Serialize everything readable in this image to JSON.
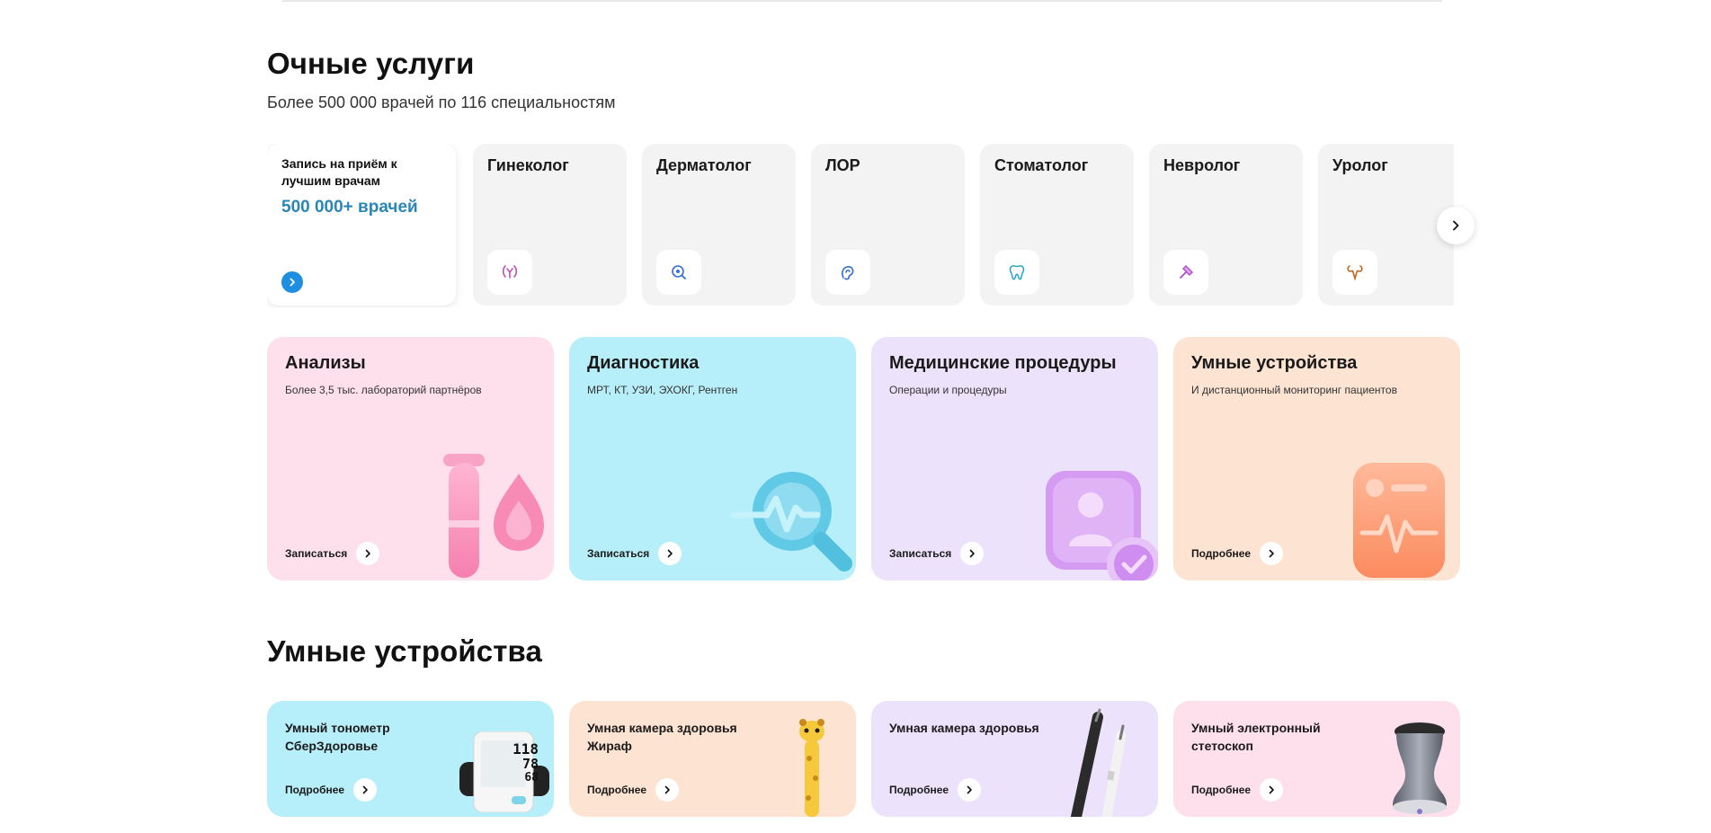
{
  "section_services": {
    "title": "Очные услуги",
    "subtitle": "Более 500 000 врачей по 116 специальностям"
  },
  "promo": {
    "title": "Запись на приём к лучшим врачам",
    "count": "500 000+ врачей",
    "accent": "#2a86b8"
  },
  "specialists": [
    {
      "label": "Гинеколог",
      "icon": "uterus-icon",
      "color": "#c24fb0"
    },
    {
      "label": "Дерматолог",
      "icon": "magnifier-icon",
      "color": "#2f6fd6"
    },
    {
      "label": "ЛОР",
      "icon": "ear-icon",
      "color": "#2f6fd6"
    },
    {
      "label": "Стоматолог",
      "icon": "tooth-icon",
      "color": "#24a6c9"
    },
    {
      "label": "Невролог",
      "icon": "hammer-icon",
      "color": "#b14bc9"
    },
    {
      "label": "Уролог",
      "icon": "kidney-icon",
      "color": "#c2651c"
    }
  ],
  "categories": [
    {
      "title": "Анализы",
      "subtitle": "Более 3,5 тыс. лабораторий партнёров",
      "link": "Записаться",
      "bg": "#fde0ec",
      "icon": "test-tube-blood-icon"
    },
    {
      "title": "Диагностика",
      "subtitle": "МРТ, КТ, УЗИ, ЭХОКГ, Рентген",
      "link": "Записаться",
      "bg": "#b6eef9",
      "icon": "pulse-magnifier-icon"
    },
    {
      "title": "Медицинские процедуры",
      "subtitle": "Операции и процедуры",
      "link": "Записаться",
      "bg": "#ede2fb",
      "icon": "patient-check-icon"
    },
    {
      "title": "Умные устройства",
      "subtitle": "И дистанционный мониторинг пациентов",
      "link": "Подробнее",
      "bg": "#fde3d2",
      "icon": "monitor-pulse-icon"
    }
  ],
  "section_devices": {
    "title": "Умные устройства"
  },
  "devices": [
    {
      "title": "Умный тонометр СберЗдоровье",
      "link": "Подробнее",
      "bg": "#b6eef9",
      "readings": [
        "118",
        "78",
        "68"
      ]
    },
    {
      "title": "Умная камера здоровья Жираф",
      "link": "Подробнее",
      "bg": "#fde3d2"
    },
    {
      "title": "Умная камера здоровья",
      "link": "Подробнее",
      "bg": "#ede2fb"
    },
    {
      "title": "Умный электронный стетоскоп",
      "link": "Подробнее",
      "bg": "#fde0ec"
    }
  ]
}
